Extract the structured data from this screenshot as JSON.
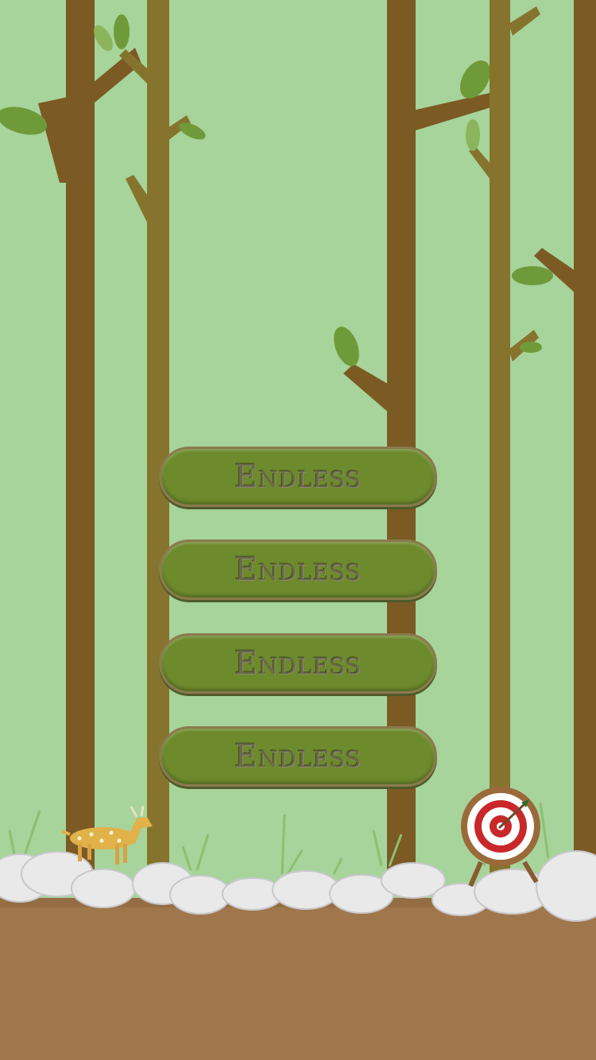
{
  "menu": {
    "buttons": [
      {
        "label": "Endless"
      },
      {
        "label": "Endless"
      },
      {
        "label": "Endless"
      },
      {
        "label": "Endless"
      }
    ]
  },
  "colors": {
    "sky": "#a6d49a",
    "trunk_dark": "#7b5a24",
    "trunk_olive": "#86742e",
    "leaf": "#6f9a3a",
    "ground": "#a0774c",
    "button": "#6d8a2c",
    "target_red": "#c9282a"
  },
  "icons": [
    "deer-icon",
    "archery-target-icon",
    "arrow-icon"
  ]
}
